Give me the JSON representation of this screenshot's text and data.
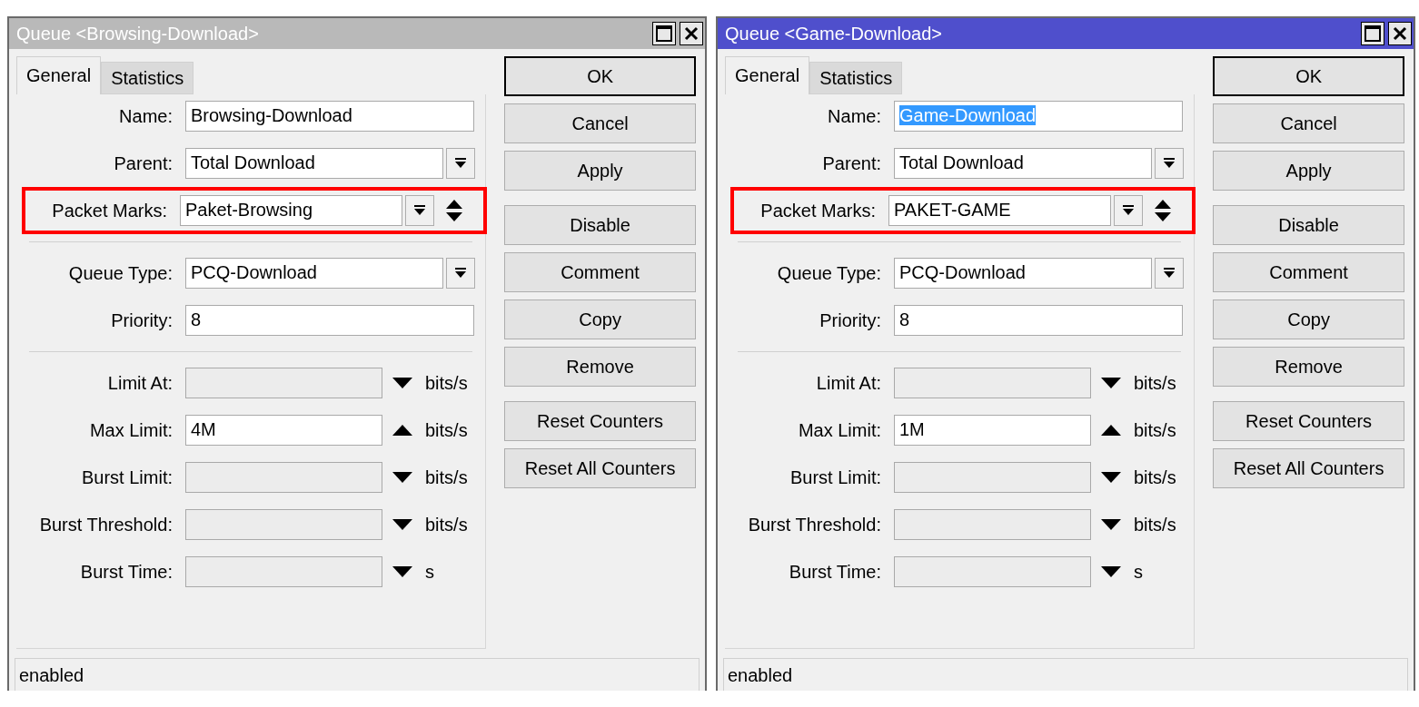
{
  "windows": [
    {
      "title": "Queue <Browsing-Download>",
      "active": false,
      "tabs": [
        {
          "label": "General",
          "selected": true
        },
        {
          "label": "Statistics",
          "selected": false
        }
      ],
      "sections": [
        [
          {
            "label": "Name:",
            "kind": "text",
            "value": "Browsing-Download",
            "text_selected": false,
            "highlighted": false
          },
          {
            "label": "Parent:",
            "kind": "select",
            "value": "Total Download",
            "highlighted": false
          },
          {
            "label": "Packet Marks:",
            "kind": "multi",
            "value": "Paket-Browsing",
            "highlighted": true
          }
        ],
        [
          {
            "label": "Queue Type:",
            "kind": "select",
            "value": "PCQ-Download",
            "highlighted": false
          },
          {
            "label": "Priority:",
            "kind": "text",
            "value": "8",
            "text_selected": false,
            "highlighted": false
          }
        ],
        [
          {
            "label": "Limit At:",
            "kind": "rate",
            "disabled": true,
            "expanded": false,
            "unit": "bits/s"
          },
          {
            "label": "Max Limit:",
            "kind": "rate",
            "value": "4M",
            "disabled": false,
            "expanded": true,
            "unit": "bits/s"
          },
          {
            "label": "Burst Limit:",
            "kind": "rate",
            "disabled": true,
            "expanded": false,
            "unit": "bits/s"
          },
          {
            "label": "Burst Threshold:",
            "kind": "rate",
            "disabled": true,
            "expanded": false,
            "unit": "bits/s"
          },
          {
            "label": "Burst Time:",
            "kind": "rate",
            "disabled": true,
            "expanded": false,
            "unit": "s"
          }
        ]
      ],
      "button_groups": [
        [
          {
            "label": "OK",
            "default": true
          },
          {
            "label": "Cancel",
            "default": false
          },
          {
            "label": "Apply",
            "default": false
          }
        ],
        [
          {
            "label": "Disable",
            "default": false
          },
          {
            "label": "Comment",
            "default": false
          },
          {
            "label": "Copy",
            "default": false
          },
          {
            "label": "Remove",
            "default": false
          }
        ],
        [
          {
            "label": "Reset Counters",
            "default": false
          },
          {
            "label": "Reset All Counters",
            "default": false
          }
        ]
      ],
      "status": "enabled"
    },
    {
      "title": "Queue <Game-Download>",
      "active": true,
      "tabs": [
        {
          "label": "General",
          "selected": true
        },
        {
          "label": "Statistics",
          "selected": false
        }
      ],
      "sections": [
        [
          {
            "label": "Name:",
            "kind": "text",
            "value": "Game-Download",
            "text_selected": true,
            "highlighted": false
          },
          {
            "label": "Parent:",
            "kind": "select",
            "value": "Total Download",
            "highlighted": false
          },
          {
            "label": "Packet Marks:",
            "kind": "multi",
            "value": "PAKET-GAME",
            "highlighted": true
          }
        ],
        [
          {
            "label": "Queue Type:",
            "kind": "select",
            "value": "PCQ-Download",
            "highlighted": false
          },
          {
            "label": "Priority:",
            "kind": "text",
            "value": "8",
            "text_selected": false,
            "highlighted": false
          }
        ],
        [
          {
            "label": "Limit At:",
            "kind": "rate",
            "disabled": true,
            "expanded": false,
            "unit": "bits/s"
          },
          {
            "label": "Max Limit:",
            "kind": "rate",
            "value": "1M",
            "disabled": false,
            "expanded": true,
            "unit": "bits/s"
          },
          {
            "label": "Burst Limit:",
            "kind": "rate",
            "disabled": true,
            "expanded": false,
            "unit": "bits/s"
          },
          {
            "label": "Burst Threshold:",
            "kind": "rate",
            "disabled": true,
            "expanded": false,
            "unit": "bits/s"
          },
          {
            "label": "Burst Time:",
            "kind": "rate",
            "disabled": true,
            "expanded": false,
            "unit": "s"
          }
        ]
      ],
      "button_groups": [
        [
          {
            "label": "OK",
            "default": true
          },
          {
            "label": "Cancel",
            "default": false
          },
          {
            "label": "Apply",
            "default": false
          }
        ],
        [
          {
            "label": "Disable",
            "default": false
          },
          {
            "label": "Comment",
            "default": false
          },
          {
            "label": "Copy",
            "default": false
          },
          {
            "label": "Remove",
            "default": false
          }
        ],
        [
          {
            "label": "Reset Counters",
            "default": false
          },
          {
            "label": "Reset All Counters",
            "default": false
          }
        ]
      ],
      "status": "enabled"
    }
  ]
}
